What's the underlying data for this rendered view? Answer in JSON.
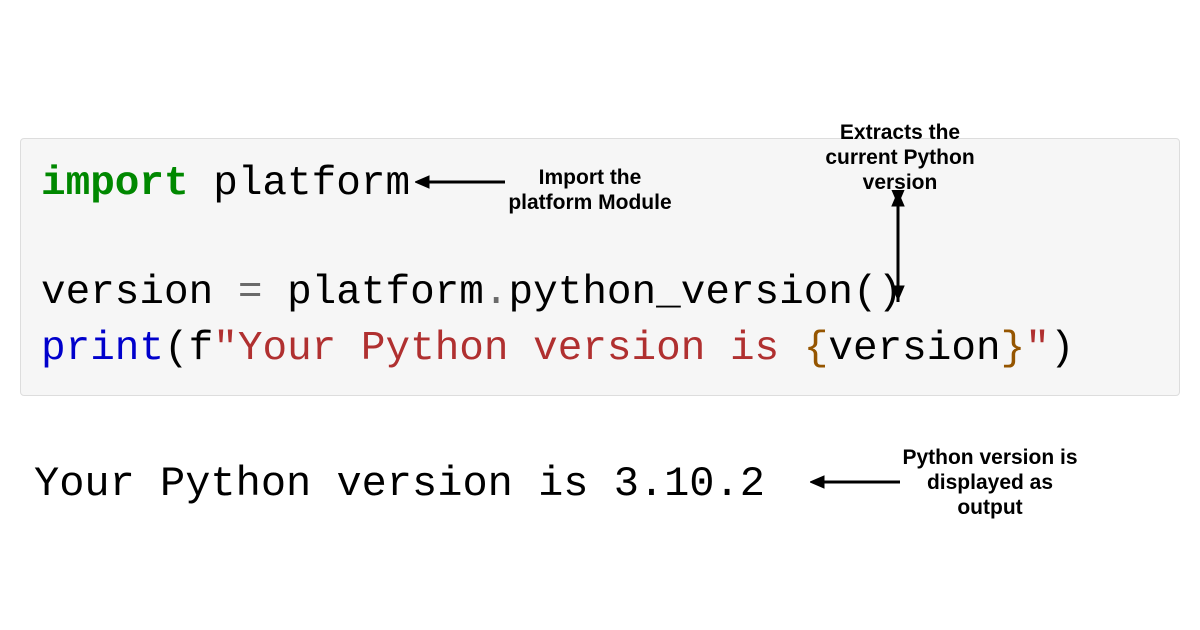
{
  "code": {
    "line1": {
      "kw": "import",
      "module": " platform"
    },
    "line2": {
      "var": "version ",
      "op": "= ",
      "obj": "platform",
      "dot": ".",
      "method": "python_version",
      "parens": "()"
    },
    "line3": {
      "fn": "print",
      "open": "(",
      "fprefix": "f",
      "q1": "\"",
      "s1": "Your Python version is ",
      "braceo": "{",
      "varref": "version",
      "bracec": "}",
      "q2": "\"",
      "close": ")"
    }
  },
  "output": "Your Python version is 3.10.2",
  "annotations": {
    "import": "Import the platform Module",
    "extract": "Extracts the current Python version",
    "output": "Python version is displayed as output"
  }
}
